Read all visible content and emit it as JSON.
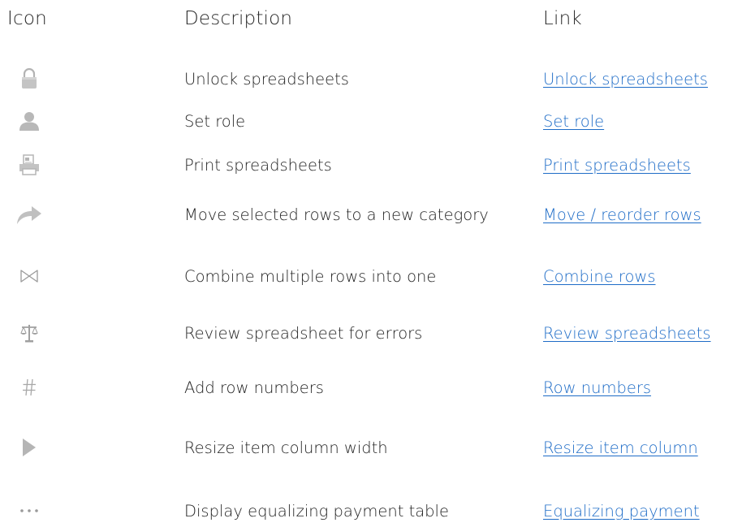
{
  "headers": {
    "icon": "Icon",
    "description": "Description",
    "link": "Link"
  },
  "colors": {
    "link": "#1e6cc7",
    "icon_gray": "#a9a9a9",
    "text": "#222222"
  },
  "rows": [
    {
      "icon": "lock-icon",
      "description": "Unlock spreadsheets",
      "link": "Unlock spreadsheets"
    },
    {
      "icon": "person-icon",
      "description": "Set role",
      "link": "Set role"
    },
    {
      "icon": "printer-icon",
      "description": "Print spreadsheets",
      "link": "Print spreadsheets"
    },
    {
      "icon": "arrow-curved-right-icon",
      "description": "Move selected rows to a new category",
      "link": "Move / reorder rows"
    },
    {
      "icon": "bowtie-icon",
      "description": "Combine multiple rows into one",
      "link": "Combine rows"
    },
    {
      "icon": "scales-icon",
      "description": "Review spreadsheet for errors",
      "link": "Review spreadsheets"
    },
    {
      "icon": "hash-icon",
      "description": "Add row numbers",
      "link": "Row numbers"
    },
    {
      "icon": "triangle-right-icon",
      "description": "Resize item column width",
      "link": "Resize item column"
    },
    {
      "icon": "ellipsis-icon",
      "description": "Display equalizing payment table",
      "link": "Equalizing payment"
    }
  ]
}
